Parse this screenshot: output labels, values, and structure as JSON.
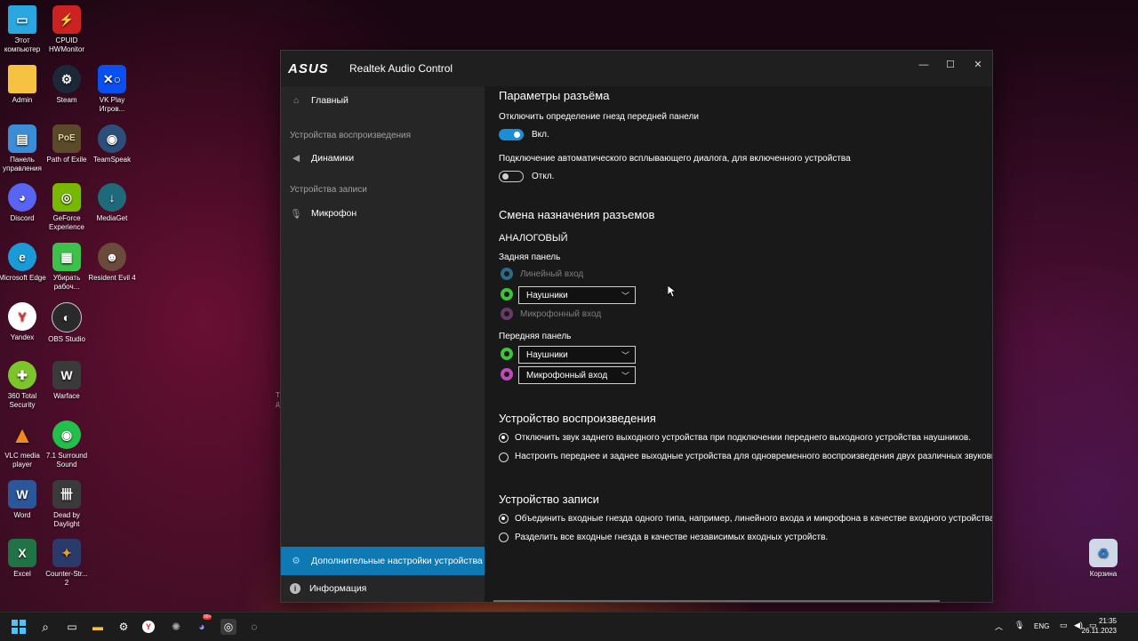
{
  "desktop": {
    "icons": [
      {
        "label": "Этот компьютер",
        "icon": "monitor-icon",
        "color": "#2aa7e0"
      },
      {
        "label": "CPUID HWMonitor",
        "icon": "hwmonitor-icon",
        "color": "#c22"
      },
      {
        "label": "Admin",
        "icon": "folder-icon",
        "color": "#f5c242"
      },
      {
        "label": "Steam",
        "icon": "steam-icon",
        "color": "#1b2838"
      },
      {
        "label": "VK Play Игров...",
        "icon": "vkplay-icon",
        "color": "#0a4ff0"
      },
      {
        "label": "Панель управления",
        "icon": "control-panel-icon",
        "color": "#3b8dd6"
      },
      {
        "label": "Path of Exile",
        "icon": "poe-icon",
        "color": "#5a4a2a"
      },
      {
        "label": "TeamSpeak",
        "icon": "teamspeak-icon",
        "color": "#2b4f7a"
      },
      {
        "label": "Discord",
        "icon": "discord-icon",
        "color": "#5865f2"
      },
      {
        "label": "GeForce Experience",
        "icon": "geforce-icon",
        "color": "#76b900"
      },
      {
        "label": "MediaGet",
        "icon": "mediaget-icon",
        "color": "#1e6a7a"
      },
      {
        "label": "Microsoft Edge",
        "icon": "edge-icon",
        "color": "#1a9bd7"
      },
      {
        "label": "Убирать рабоч...",
        "icon": "green-app-icon",
        "color": "#3cc24a"
      },
      {
        "label": "Resident Evil 4",
        "icon": "re4-icon",
        "color": "#6a4a3a"
      },
      {
        "label": "Yandex",
        "icon": "yandex-icon",
        "color": "#ffffff"
      },
      {
        "label": "OBS Studio",
        "icon": "obs-icon",
        "color": "#2a2a2a"
      },
      {
        "label": "360 Total Security",
        "icon": "360-icon",
        "color": "#7dc62a"
      },
      {
        "label": "Warface",
        "icon": "warface-icon",
        "color": "#3a3a3a"
      },
      {
        "label": "VLC media player",
        "icon": "vlc-icon",
        "color": "#f08a1a"
      },
      {
        "label": "7.1 Surround Sound",
        "icon": "surround-icon",
        "color": "#22c04a"
      },
      {
        "label": "Word",
        "icon": "word-icon",
        "color": "#2b579a"
      },
      {
        "label": "Dead by Daylight",
        "icon": "dbd-icon",
        "color": "#3a3a3a"
      },
      {
        "label": "Excel",
        "icon": "excel-icon",
        "color": "#217346"
      },
      {
        "label": "Counter-Str... 2",
        "icon": "cs2-icon",
        "color": "#2a3a6a"
      },
      {
        "label": "Корзина",
        "icon": "recycle-bin-icon",
        "color": "#cfd8e6"
      }
    ]
  },
  "window": {
    "logo": "ASUS",
    "title": "Realtek Audio Control",
    "controls": {
      "minimize": "—",
      "maximize": "☐",
      "close": "✕"
    }
  },
  "sidebar": {
    "home": "Главный",
    "playback_section": "Устройства воспроизведения",
    "speakers": "Динамики",
    "record_section": "Устройства записи",
    "microphone": "Микрофон",
    "advanced": "Дополнительные настройки устройства",
    "info": "Информация"
  },
  "content": {
    "jack_params_title": "Параметры разъёма",
    "front_detect_label": "Отключить определение гнезд передней панели",
    "front_detect_state": "Вкл.",
    "auto_popup_label": "Подключение автоматического всплывающего диалога, для включенного устройства",
    "auto_popup_state": "Откл.",
    "reassign_title": "Смена назначения разъемов",
    "analog": "АНАЛОГОВЫЙ",
    "rear_panel": "Задняя панель",
    "rear_line_in": "Линейный вход",
    "rear_headphones": "Наушники",
    "rear_mic_in": "Микрофонный вход",
    "front_panel": "Передняя панель",
    "front_headphones": "Наушники",
    "front_mic": "Микрофонный вход",
    "playback_title": "Устройство воспроизведения",
    "playback_opt1": "Отключить звук заднего выходного устройства при подключении переднего выходного устройства наушников.",
    "playback_opt2": "Настроить переднее и заднее выходные устройства для одновременного воспроизведения двух различных звуковых",
    "record_title": "Устройство записи",
    "record_opt1": "Объединить входные гнезда одного типа, например, линейного входа и микрофона в качестве входного устройства",
    "record_opt2": "Разделить все входные гнезда в качестве независимых входных устройств."
  },
  "jack_colors": {
    "line_in": "#2a6a8a",
    "headphones": "#3cc43c",
    "mic": "#c04ab8",
    "mic_dim": "#6a3a66"
  },
  "taskbar": {
    "lang": "ENG",
    "time": "21:35",
    "date": "26.11.2023",
    "discord_badge": "99+"
  },
  "stray_text": "Т\nд"
}
